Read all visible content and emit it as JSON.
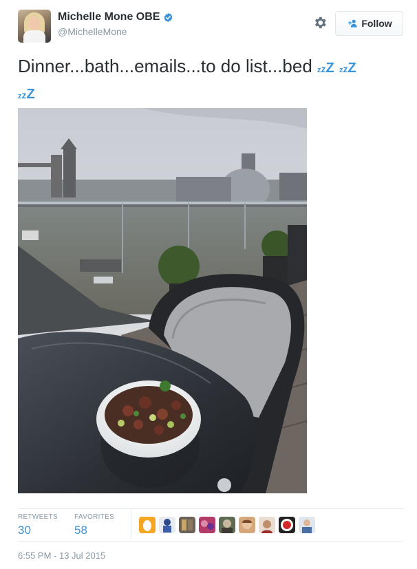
{
  "user": {
    "name": "Michelle Mone OBE",
    "handle": "@MichelleMone"
  },
  "follow_button": {
    "label": "Follow"
  },
  "tweet": {
    "text": "Dinner...bath...emails...to do list...bed",
    "emoji_zzz": "zzZ"
  },
  "stats": {
    "retweets_label": "RETWEETS",
    "retweets_value": "30",
    "favorites_label": "FAVORITES",
    "favorites_value": "58"
  },
  "timestamp": "6:55 PM - 13 Jul 2015",
  "colors": {
    "accent": "#3b94d9",
    "text": "#292f33",
    "muted": "#8899a6",
    "border": "#e1e8ed"
  },
  "icons": [
    "verified-badge-icon",
    "gear-icon",
    "follow-person-icon"
  ]
}
